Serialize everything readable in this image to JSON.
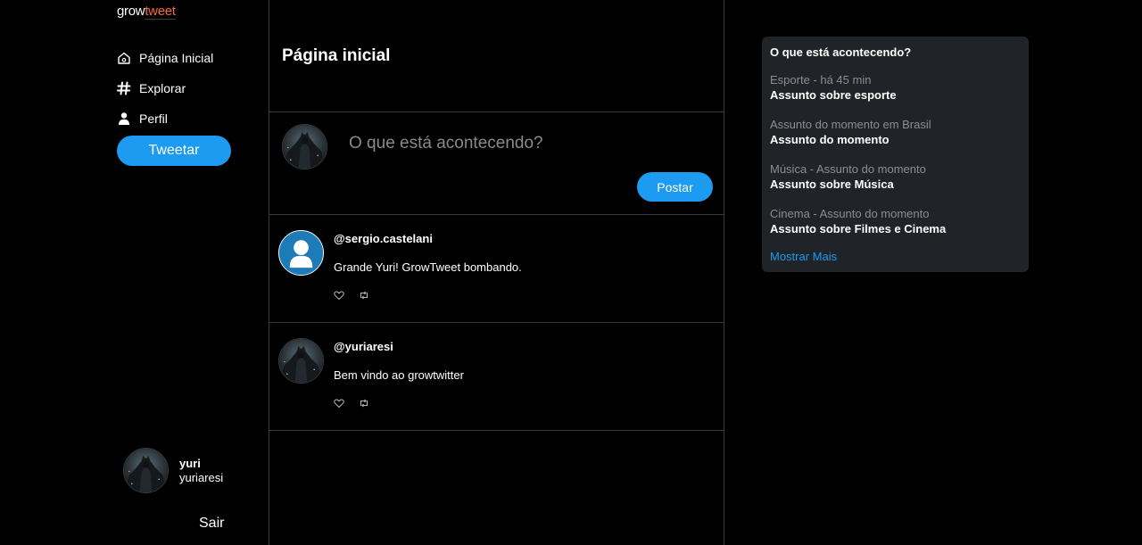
{
  "logo": {
    "part1": "grow",
    "part2": "tweet"
  },
  "sidebar": {
    "items": [
      {
        "label": "Página Inicial",
        "icon": "home-icon"
      },
      {
        "label": "Explorar",
        "icon": "hashtag-icon"
      },
      {
        "label": "Perfil",
        "icon": "user-icon"
      }
    ],
    "tweet_button": "Tweetar",
    "profile": {
      "name": "yuri",
      "handle": "yuriaresi"
    },
    "logout": "Sair"
  },
  "feed": {
    "title": "Página inicial",
    "composer": {
      "placeholder": "O que está acontecendo?",
      "post_button": "Postar"
    },
    "tweets": [
      {
        "handle": "@sergio.castelani",
        "text": "Grande Yuri! GrowTweet bombando.",
        "avatar": "default-user-icon"
      },
      {
        "handle": "@yuriaresi",
        "text": "Bem vindo ao growtwitter",
        "avatar": "batman-avatar"
      }
    ]
  },
  "trends": {
    "title": "O que está acontecendo?",
    "items": [
      {
        "meta": "Esporte - há 45 min",
        "topic": "Assunto sobre esporte"
      },
      {
        "meta": "Assunto do momento em Brasil",
        "topic": "Assunto do momento"
      },
      {
        "meta": "Música - Assunto do momento",
        "topic": "Assunto sobre Música"
      },
      {
        "meta": "Cinema - Assunto do momento",
        "topic": "Assunto sobre Filmes e Cinema"
      }
    ],
    "show_more": "Mostrar Mais"
  },
  "colors": {
    "accent": "#1d9bf0",
    "logo_accent": "#f0663a",
    "panel": "#202327",
    "border": "#3a3a3a"
  }
}
